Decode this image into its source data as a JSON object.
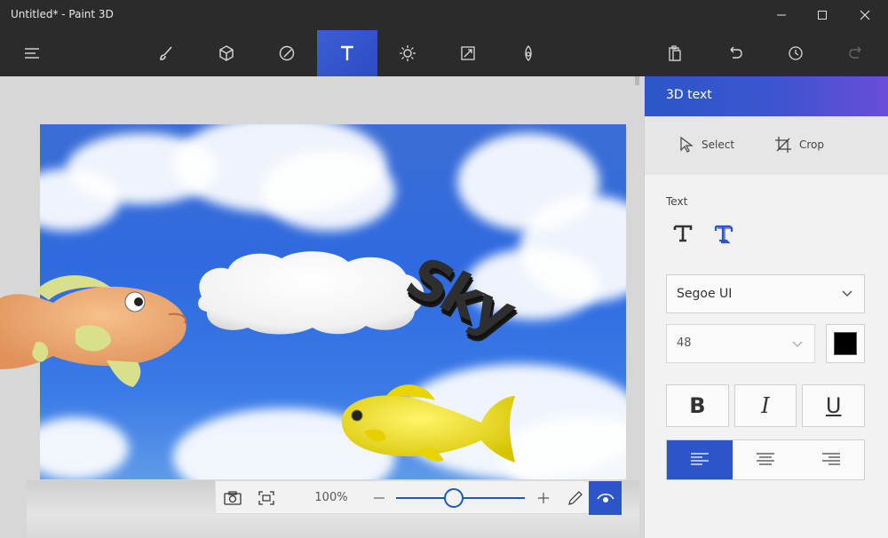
{
  "window": {
    "title": "Untitled* - Paint 3D"
  },
  "toolbar": {
    "items": [
      {
        "name": "brushes",
        "active": false
      },
      {
        "name": "3d-objects",
        "active": false
      },
      {
        "name": "stickers",
        "active": false
      },
      {
        "name": "text",
        "active": true
      },
      {
        "name": "effects",
        "active": false
      },
      {
        "name": "canvas",
        "active": false
      },
      {
        "name": "3d-library",
        "active": false
      }
    ]
  },
  "canvas": {
    "sky_text": "Sky"
  },
  "zoom": {
    "percent": "100%",
    "level": 0.45
  },
  "panel": {
    "title": "3D text",
    "select_label": "Select",
    "crop_label": "Crop",
    "text_section_label": "Text",
    "font_name": "Segoe UI",
    "font_size": "48",
    "text_color": "#000000",
    "bold_label": "B",
    "italic_label": "I",
    "underline_label": "U",
    "alignment": "left"
  },
  "colors": {
    "accent": "#2d55c8",
    "chrome": "#2b2b2b"
  }
}
